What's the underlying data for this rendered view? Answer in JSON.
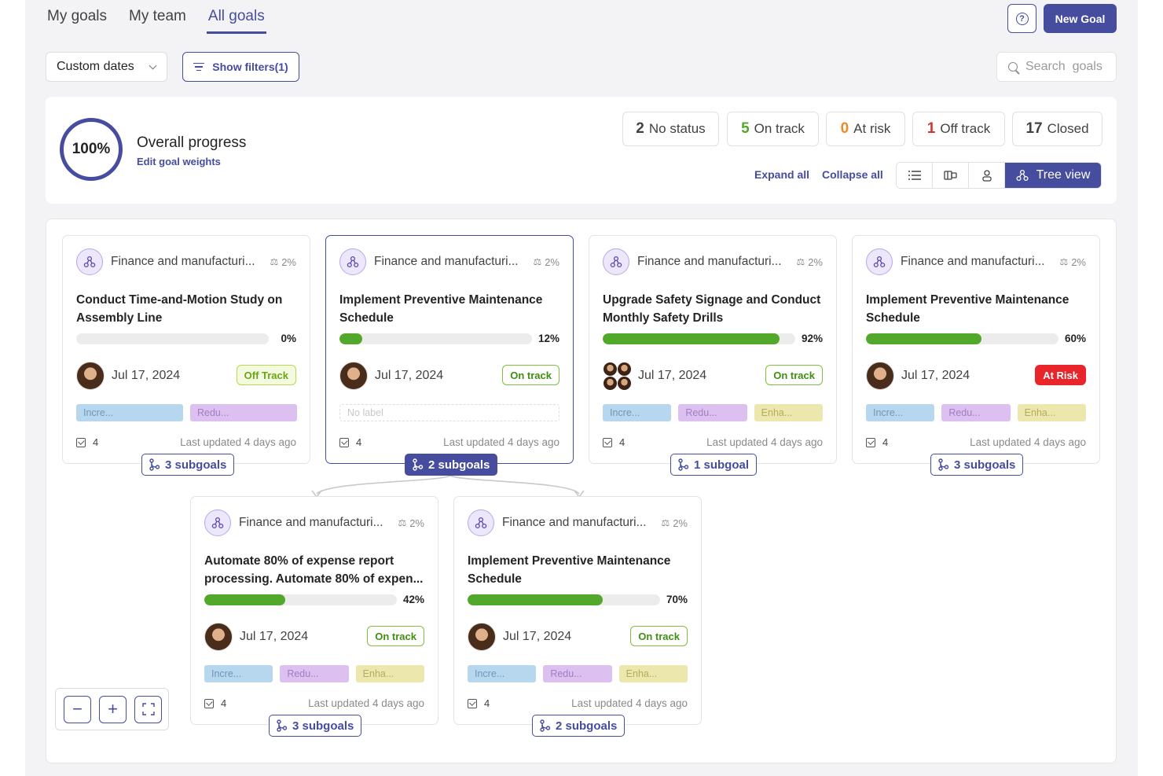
{
  "nav": {
    "tabs": [
      {
        "label": "My goals",
        "active": false
      },
      {
        "label": "My team",
        "active": false
      },
      {
        "label": "All goals",
        "active": true
      }
    ],
    "new_goal_label": "New Goal"
  },
  "filters": {
    "date_label": "Custom dates",
    "show_filters_label": "Show filters(1)",
    "search_placeholder": "Search  goals"
  },
  "overview": {
    "progress_value": "100%",
    "title": "Overall progress",
    "edit_link": "Edit goal weights",
    "stats": [
      {
        "count": "2",
        "label": "No status",
        "color": "#242424"
      },
      {
        "count": "5",
        "label": "On track",
        "color": "#52a82a"
      },
      {
        "count": "0",
        "label": "At risk",
        "color": "#f08a24"
      },
      {
        "count": "1",
        "label": "Off track",
        "color": "#d13438"
      },
      {
        "count": "17",
        "label": "Closed",
        "color": "#242424"
      }
    ],
    "expand_all": "Expand all",
    "collapse_all": "Collapse all",
    "tree_view_label": "Tree view"
  },
  "cards": [
    {
      "category": "Finance and manufacturi...",
      "weight": "2%",
      "title": "Conduct Time-and-Motion Study on Assembly Line",
      "progress": 0,
      "progress_label": "0%",
      "date": "Jul 17, 2024",
      "status": "Off Track",
      "labels": [
        "Incre...",
        "Redu..."
      ],
      "tasks": "4",
      "updated": "Last updated 4 days ago",
      "subgoals": "3 subgoals"
    },
    {
      "category": "Finance and manufacturi...",
      "weight": "2%",
      "title": "Implement Preventive Maintenance Schedule",
      "progress": 12,
      "progress_label": "12%",
      "date": "Jul 17, 2024",
      "status": "On track",
      "labels": [],
      "no_label": "No label",
      "tasks": "4",
      "updated": "Last updated 4 days ago",
      "subgoals": "2 subgoals"
    },
    {
      "category": "Finance and manufacturi...",
      "weight": "2%",
      "title": "Upgrade Safety Signage and Conduct Monthly Safety Drills",
      "progress": 92,
      "progress_label": "92%",
      "date": "Jul 17, 2024",
      "status": "On track",
      "labels": [
        "Incre...",
        "Redu...",
        "Enha..."
      ],
      "tasks": "4",
      "updated": "Last updated 4 days ago",
      "subgoals": "1 subgoal"
    },
    {
      "category": "Finance and manufacturi...",
      "weight": "2%",
      "title": "Implement Preventive Maintenance Schedule",
      "progress": 60,
      "progress_label": "60%",
      "date": "Jul 17, 2024",
      "status": "At Risk",
      "labels": [
        "Incre...",
        "Redu...",
        "Enha..."
      ],
      "tasks": "4",
      "updated": "Last updated 4 days ago",
      "subgoals": "3 subgoals"
    },
    {
      "category": "Finance and manufacturi...",
      "weight": "2%",
      "title": "Automate 80% of expense report processing. Automate 80% of expen...",
      "progress": 42,
      "progress_label": "42%",
      "date": "Jul 17, 2024",
      "status": "On track",
      "labels": [
        "Incre...",
        "Redu...",
        "Enha..."
      ],
      "tasks": "4",
      "updated": "Last updated 4 days ago",
      "subgoals": "3 subgoals"
    },
    {
      "category": "Finance and manufacturi...",
      "weight": "2%",
      "title": "Implement Preventive Maintenance Schedule",
      "progress": 70,
      "progress_label": "70%",
      "date": "Jul 17, 2024",
      "status": "On track",
      "labels": [
        "Incre...",
        "Redu...",
        "Enha..."
      ],
      "tasks": "4",
      "updated": "Last updated 4 days ago",
      "subgoals": "2 subgoals"
    }
  ],
  "colors": {
    "accent": "#464c9e",
    "progress_fill": "#52a82a",
    "at_risk": "#e8252b"
  }
}
